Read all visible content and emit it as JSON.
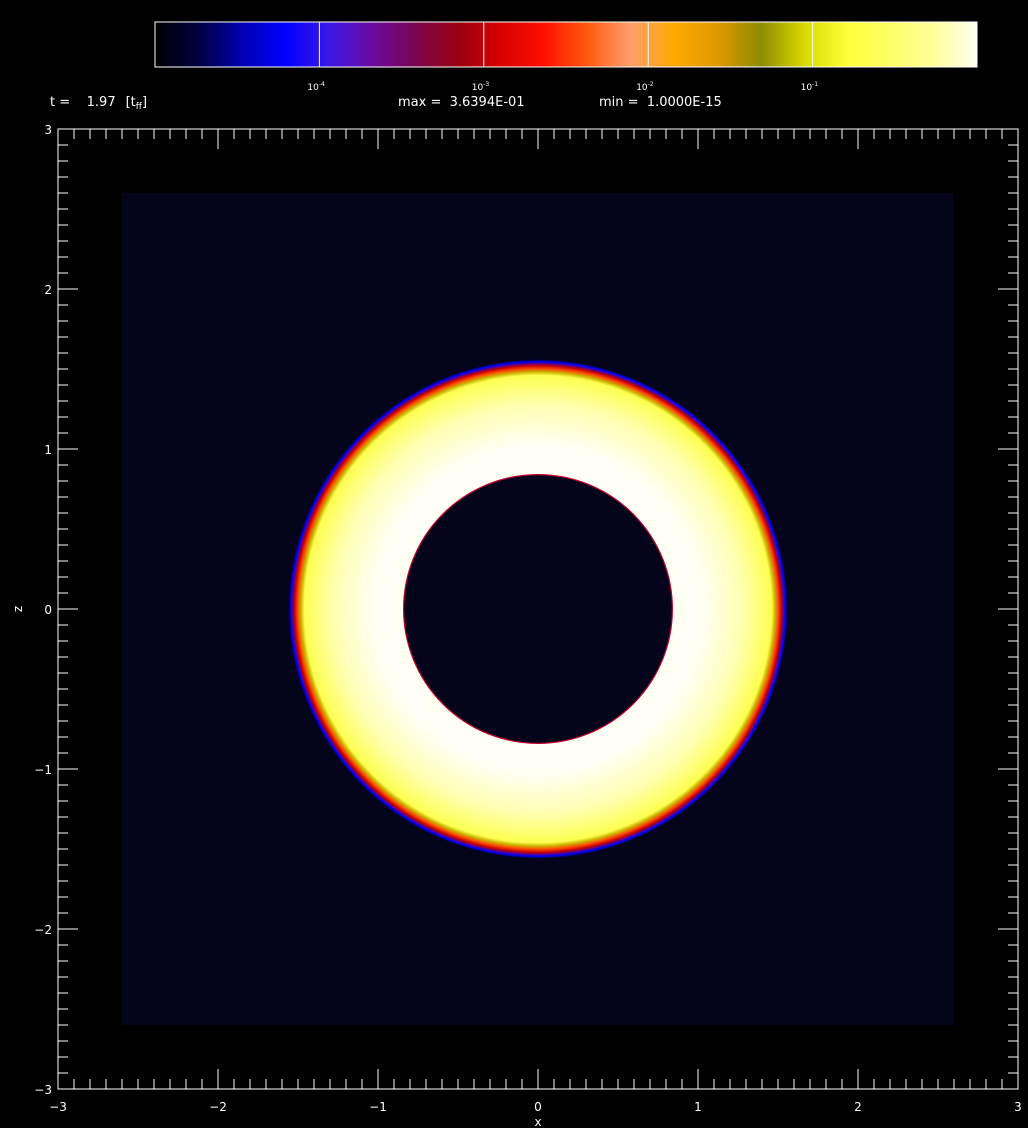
{
  "header": {
    "time_text": "t =    1.97",
    "time_unit_text": "[t",
    "time_unit_sub": "ff",
    "time_unit_close": "]",
    "max_text": "max =  3.6394E-01",
    "min_text": "min =  1.0000E-15"
  },
  "colorbar": {
    "tick_base": "10",
    "ticks": [
      {
        "exp": "-4",
        "value": 0.0001
      },
      {
        "exp": "-3",
        "value": 0.001
      },
      {
        "exp": "-2",
        "value": 0.01
      },
      {
        "exp": "-1",
        "value": 0.1
      }
    ],
    "log_range": [
      -5,
      0
    ],
    "colors": [
      "#000000",
      "#000040",
      "#0000b0",
      "#0000ff",
      "#3a18e6",
      "#6a0aa0",
      "#7a0550",
      "#9a0010",
      "#d80000",
      "#ff1000",
      "#ff5a10",
      "#ff9e6c",
      "#ffa800",
      "#e09800",
      "#8c8c00",
      "#d8d800",
      "#ffff3a",
      "#ffff66",
      "#ffff99",
      "#fffff0"
    ]
  },
  "chart_data": {
    "type": "heatmap",
    "title": "",
    "xlabel": "x",
    "ylabel": "z",
    "xlim": [
      -3,
      3
    ],
    "ylim": [
      -3,
      3
    ],
    "x_ticks": [
      -3,
      -2,
      -1,
      0,
      1,
      2,
      3
    ],
    "y_ticks": [
      -3,
      -2,
      -1,
      0,
      1,
      2,
      3
    ],
    "x_tick_labels": [
      "−3",
      "−2",
      "−1",
      "0",
      "1",
      "2",
      "3"
    ],
    "y_tick_labels": [
      "−3",
      "−2",
      "−1",
      "0",
      "1",
      "2",
      "3"
    ],
    "domain_extent": [
      -2.6,
      2.6
    ],
    "background_color": "#04041a",
    "shell": {
      "center": [
        0,
        0
      ],
      "inner_radius": 0.84,
      "outer_radius": 1.56,
      "colors": [
        "#0000ff",
        "#c80000",
        "#ff5000",
        "#c8b400",
        "#ffff50",
        "#ffffb0",
        "#fffff4"
      ]
    }
  }
}
